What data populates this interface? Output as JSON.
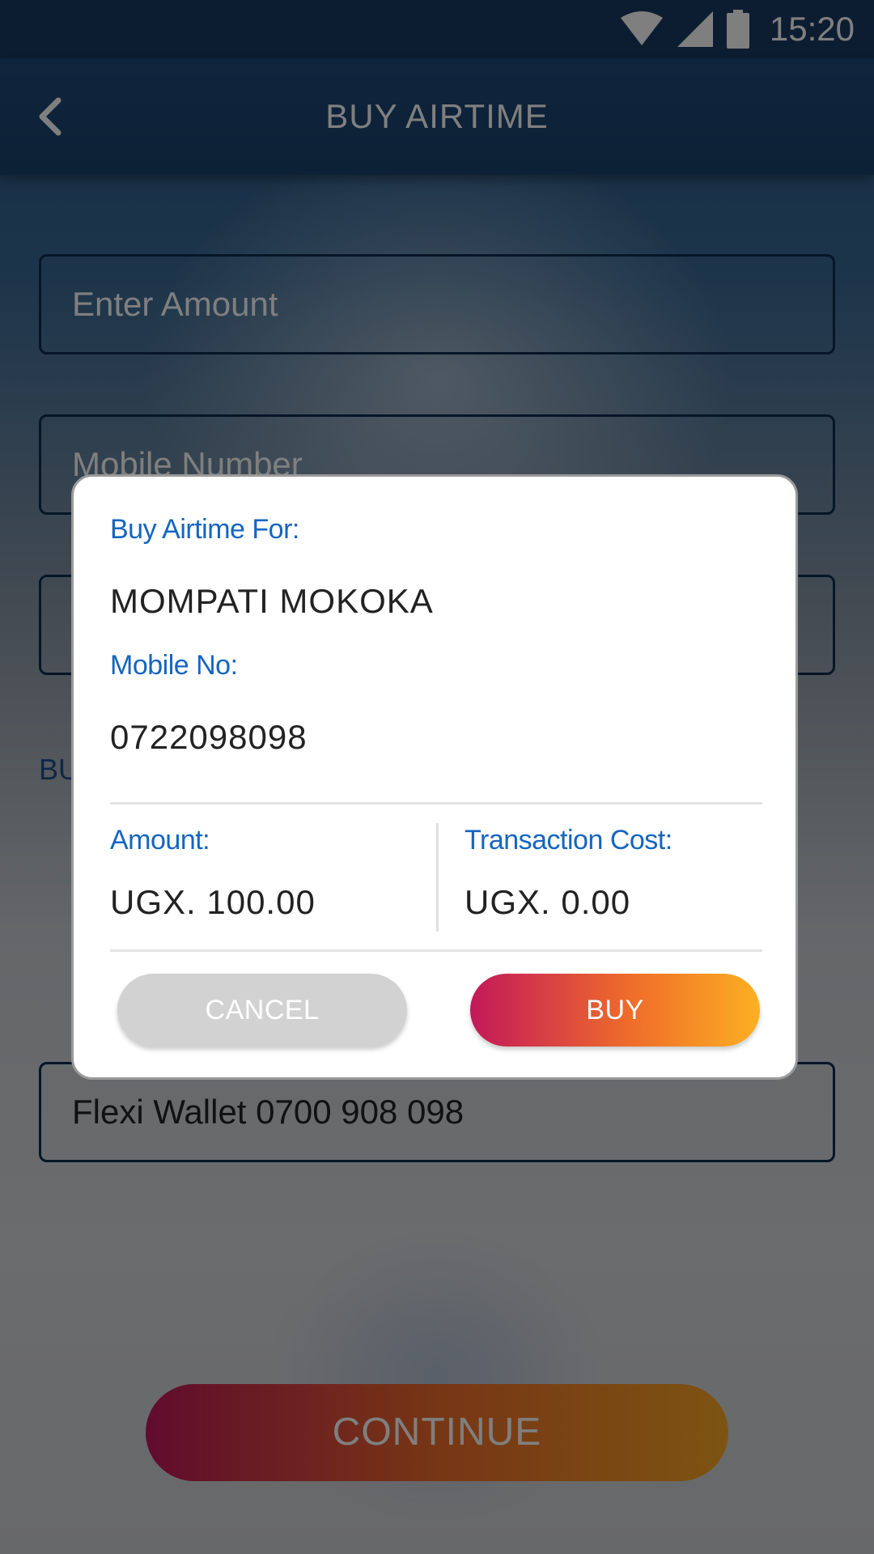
{
  "status_bar": {
    "time": "15:20",
    "icons": [
      "wifi-icon",
      "signal-icon",
      "battery-icon"
    ]
  },
  "app_bar": {
    "title": "BUY AIRTIME",
    "back_icon": "chevron-left-icon"
  },
  "form": {
    "amount_placeholder": "Enter Amount",
    "mobile_placeholder": "Mobile Number",
    "section_label_partial": "BU",
    "wallet_value": "Flexi Wallet 0700 908 098",
    "continue_label": "CONTINUE"
  },
  "dialog": {
    "buy_for_label": "Buy Airtime For:",
    "buy_for_value": "MOMPATI MOKOKA",
    "mobile_label": "Mobile No:",
    "mobile_value": "0722098098",
    "amount_label": "Amount:",
    "amount_value": "UGX. 100.00",
    "cost_label": "Transaction Cost:",
    "cost_value": "UGX. 0.00",
    "cancel_label": "CANCEL",
    "buy_label": "BUY"
  },
  "colors": {
    "accent_blue": "#1565c0",
    "brand_gradient_start": "#c2185b",
    "brand_gradient_end": "#f9a825",
    "app_bar": "#1e4b7a"
  }
}
